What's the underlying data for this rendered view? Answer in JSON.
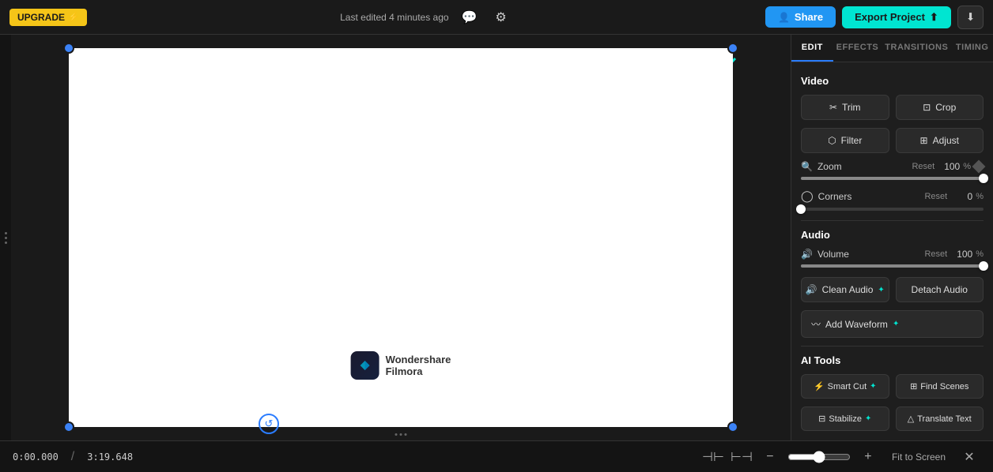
{
  "topbar": {
    "upgrade_label": "UPGRADE",
    "last_edited": "Last edited 4 minutes ago",
    "share_label": "Share",
    "export_label": "Export Project",
    "download_icon": "⬇"
  },
  "tabs": {
    "edit": "EDIT",
    "effects": "EFFECTS",
    "transitions": "TRANSITIONS",
    "timing": "TIMING"
  },
  "panel": {
    "video_section": "Video",
    "trim_label": "Trim",
    "crop_label": "Crop",
    "filter_label": "Filter",
    "adjust_label": "Adjust",
    "zoom_label": "Zoom",
    "zoom_value": "100",
    "zoom_reset": "Reset",
    "corners_label": "Corners",
    "corners_value": "0",
    "corners_reset": "Reset",
    "audio_section": "Audio",
    "volume_label": "Volume",
    "volume_value": "100",
    "volume_reset": "Reset",
    "clean_audio_label": "Clean Audio",
    "detach_audio_label": "Detach Audio",
    "add_waveform_label": "Add Waveform",
    "ai_tools_section": "AI Tools",
    "smart_cut_label": "Smart Cut",
    "find_scenes_label": "Find Scenes",
    "stabilize_label": "Stabilize",
    "translate_text_label": "Translate Text"
  },
  "canvas": {
    "watermark_line1": "Wondershare",
    "watermark_line2": "Filmora"
  },
  "bottombar": {
    "current_time": "0:00.000",
    "total_time": "3:19.648",
    "fit_label": "Fit to Screen",
    "separator": "/"
  }
}
